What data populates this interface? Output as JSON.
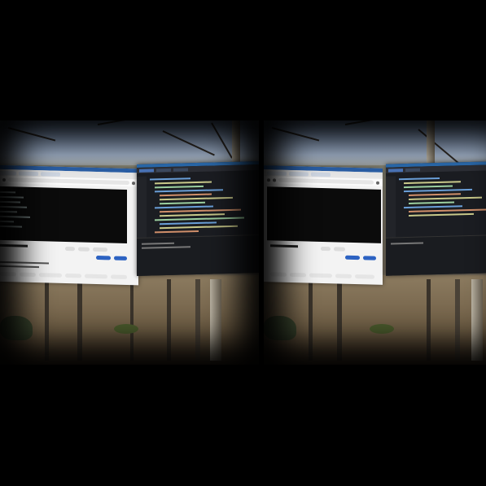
{
  "scene": {
    "description_free": true,
    "views": [
      "left-eye",
      "right-eye"
    ]
  },
  "browser": {
    "tabs": 3,
    "accent": "#2a5fa6",
    "subscribe_color": "#2c62c2"
  },
  "editor": {
    "accent": "#2b6cb0",
    "background": "#1b1d22"
  },
  "icons": [
    "back-icon",
    "reload-icon",
    "menu-icon"
  ]
}
